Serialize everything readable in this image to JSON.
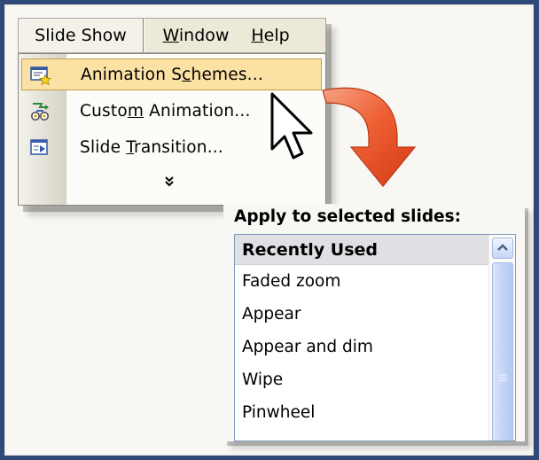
{
  "menubar": {
    "items": [
      {
        "label": "Slide Show"
      },
      {
        "label_pre": "",
        "label_u": "W",
        "label_post": "indow"
      },
      {
        "label_pre": "",
        "label_u": "H",
        "label_post": "elp"
      }
    ]
  },
  "dropdown": {
    "items": [
      {
        "pre": "Animation S",
        "u": "c",
        "post": "hemes...",
        "icon": "animation-schemes-icon",
        "highlighted": true
      },
      {
        "pre": "Custo",
        "u": "m",
        "post": " Animation...",
        "icon": "custom-animation-icon"
      },
      {
        "pre": "Slide ",
        "u": "T",
        "post": "ransition...",
        "icon": "slide-transition-icon"
      }
    ],
    "more": "expand-chevron-icon"
  },
  "panel": {
    "title": "Apply to selected slides:",
    "header": "Recently Used",
    "rows": [
      "Faded zoom",
      "Appear",
      "Appear and dim",
      "Wipe",
      "Pinwheel"
    ]
  },
  "colors": {
    "highlight": "#fbe1a4",
    "highlight_border": "#c1a04c",
    "arrow": "#e8451c",
    "frame": "#2d4a78"
  }
}
